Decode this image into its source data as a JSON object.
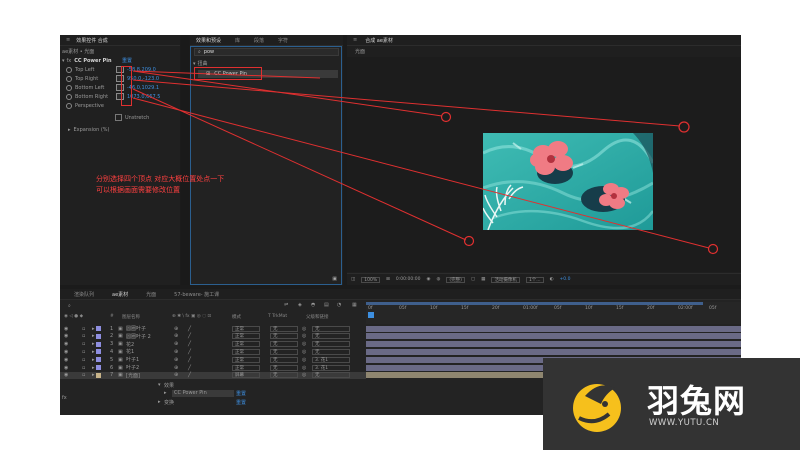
{
  "colors": {
    "accent": "#3d8fe0",
    "annotation": "#ff3b3b",
    "logo_yellow": "#f6c01c"
  },
  "effects_panel": {
    "tabs": [
      "效果控件 合成",
      "效果和预设",
      "库",
      "段落",
      "字符"
    ],
    "breadcrumb": "ae素材 • 光面",
    "effect_name": "CC Power Pin",
    "reset_label": "重置",
    "properties": [
      {
        "name": "Top Left",
        "value": "-58.8,209.0"
      },
      {
        "name": "Top Right",
        "value": "950.0,-123.0"
      },
      {
        "name": "Bottom Left",
        "value": "-46.0,1029.1"
      },
      {
        "name": "Bottom Right",
        "value": "1073.0,667.5"
      },
      {
        "name": "Perspective",
        "value": ""
      }
    ],
    "unstretch_label": "Unstretch",
    "expansion_label": "Expansion (%)"
  },
  "presets_panel": {
    "search_value": "pow",
    "category": "扭曲",
    "result_item": "CC Power Pin"
  },
  "composition_panel": {
    "tab": "合成 ae素材",
    "breadcrumb": "光面",
    "zoom": "100%",
    "timecode": "0:00:00:00",
    "quality": "(完整)",
    "camera": "活动摄像机",
    "views": "1个...",
    "exposure": "+0.0"
  },
  "timeline": {
    "tabs": [
      "渲染队列",
      "ae素材",
      "光面",
      "57-beware- 施工课"
    ],
    "column_headers": [
      "#",
      "图层名称",
      "模式",
      "T TrkMat",
      "父级和链接"
    ],
    "ruler": [
      "0f",
      "05f",
      "10f",
      "15f",
      "20f",
      "01:00f",
      "05f",
      "10f",
      "15f",
      "20f",
      "02:00f",
      "05f"
    ],
    "layers": [
      {
        "num": "1",
        "name": "圆圈叶子",
        "mode": "正常",
        "trkmat": "无",
        "parent": "无",
        "color": "#8e8ee0"
      },
      {
        "num": "2",
        "name": "圆圈叶子 2",
        "mode": "正常",
        "trkmat": "无",
        "parent": "无",
        "color": "#8e8ee0"
      },
      {
        "num": "3",
        "name": "花2",
        "mode": "正常",
        "trkmat": "无",
        "parent": "无",
        "color": "#8e8ee0"
      },
      {
        "num": "4",
        "name": "花1",
        "mode": "正常",
        "trkmat": "无",
        "parent": "无",
        "color": "#8e8ee0"
      },
      {
        "num": "5",
        "name": "叶子1",
        "mode": "正常",
        "trkmat": "无",
        "parent": "3. 花1",
        "color": "#8e8ee0"
      },
      {
        "num": "6",
        "name": "叶子2",
        "mode": "正常",
        "trkmat": "无",
        "parent": "3. 花1",
        "color": "#8e8ee0"
      },
      {
        "num": "7",
        "name": "[光面]",
        "mode": "屏幕",
        "trkmat": "无",
        "parent": "无",
        "color": "#c8b48a"
      }
    ],
    "sub_effects": "效果",
    "sub_effect_name": "CC Power Pin",
    "sub_reset": "重置",
    "sub_transform": "变换",
    "sub_transform_reset": "重置"
  },
  "annotation": {
    "line1": "分别选择四个顶点 对应大概位置处点一下",
    "line2": "可以根据画面需要修改位置"
  },
  "logo": {
    "name": "羽兔网",
    "url": "WWW.YUTU.CN"
  }
}
